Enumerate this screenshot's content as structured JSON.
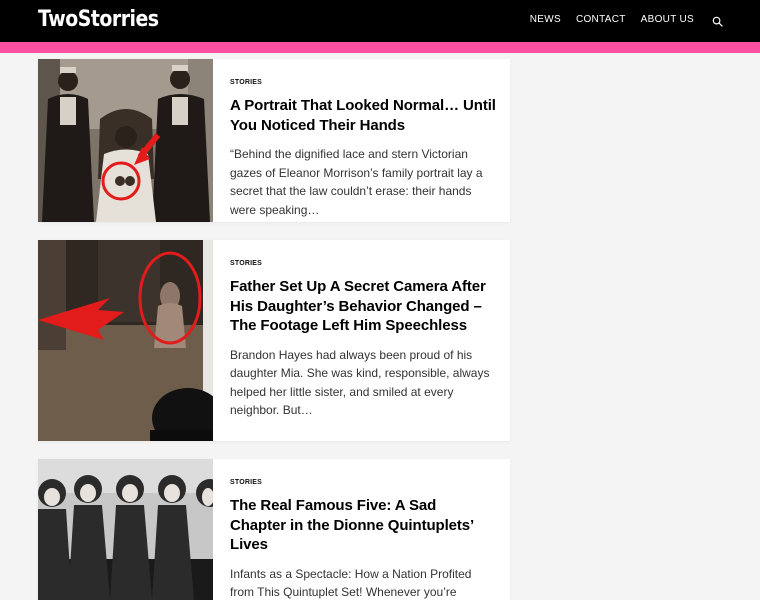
{
  "site": {
    "logo": "TwoStorries",
    "nav": [
      {
        "label": "NEWS"
      },
      {
        "label": "CONTACT"
      },
      {
        "label": "ABOUT US"
      }
    ]
  },
  "articles": [
    {
      "category": "STORIES",
      "title": "A Portrait That Looked Normal… Until You Noticed Their Hands",
      "excerpt": "“Behind the dignified lace and stern Victorian gazes of Eleanor Morrison’s family portrait lay a secret that the law couldn’t erase: their hands were speaking…"
    },
    {
      "category": "STORIES",
      "title": "Father Set Up A Secret Camera After His Daughter’s Behavior Changed – The Footage Left Him Speechless",
      "excerpt": "Brandon Hayes had always been proud of his daughter Mia. She was kind, responsible, always helped her little sister, and smiled at every neighbor. But…"
    },
    {
      "category": "STORIES",
      "title": "The Real Famous Five: A Sad Chapter in the Dionne Quintuplets’ Lives",
      "excerpt": "Infants as a Spectacle: How a Nation Profited from This Quintuplet Set! Whenever you’re tempted to"
    }
  ]
}
